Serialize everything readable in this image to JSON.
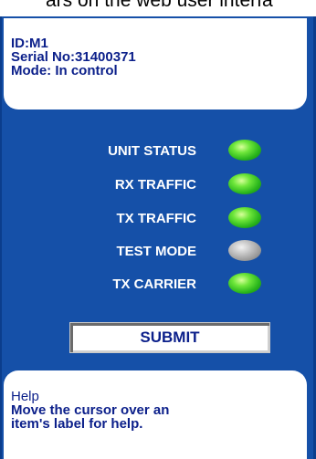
{
  "top_caption": "ars on the web user interfa",
  "info": {
    "id_line": "ID:M1",
    "serial_line": "Serial No:31400371",
    "mode_line": "Mode: In control"
  },
  "status_items": [
    {
      "label": "UNIT STATUS",
      "indicator": "led-green-on",
      "state": "on"
    },
    {
      "label": "RX TRAFFIC",
      "indicator": "led-green-on",
      "state": "on"
    },
    {
      "label": "TX TRAFFIC",
      "indicator": "led-green-on",
      "state": "on"
    },
    {
      "label": "TEST MODE",
      "indicator": "led-gray-off",
      "state": "off"
    },
    {
      "label": "TX CARRIER",
      "indicator": "led-green-on",
      "state": "on"
    }
  ],
  "submit_label": "SUBMIT",
  "help": {
    "title": "Help",
    "text_line1": "Move the cursor over an",
    "text_line2": "item's label for help."
  },
  "colors": {
    "panel_background": "#1550a8",
    "text_navy": "#0b1f8a",
    "led_on": "#28b41c",
    "led_off": "#979797"
  }
}
